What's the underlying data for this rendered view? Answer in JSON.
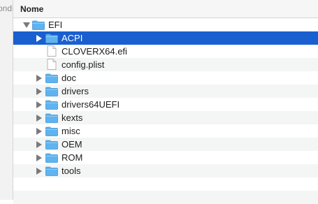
{
  "sidebar": {
    "clipped_label": "ondi"
  },
  "header": {
    "column_title": "Nome"
  },
  "colors": {
    "selection": "#1a5fcf",
    "folder": "#5fb3ef"
  },
  "rows": [
    {
      "name": "EFI",
      "kind": "folder",
      "level": 0,
      "disclosure": "expanded",
      "selected": false,
      "icon": "folder-icon"
    },
    {
      "name": "ACPI",
      "kind": "folder",
      "level": 1,
      "disclosure": "collapsed",
      "selected": true,
      "icon": "folder-icon"
    },
    {
      "name": "CLOVERX64.efi",
      "kind": "file",
      "level": 1,
      "disclosure": "none",
      "selected": false,
      "icon": "document-icon"
    },
    {
      "name": "config.plist",
      "kind": "file",
      "level": 1,
      "disclosure": "none",
      "selected": false,
      "icon": "document-icon"
    },
    {
      "name": "doc",
      "kind": "folder",
      "level": 1,
      "disclosure": "collapsed",
      "selected": false,
      "icon": "folder-icon"
    },
    {
      "name": "drivers",
      "kind": "folder",
      "level": 1,
      "disclosure": "collapsed",
      "selected": false,
      "icon": "folder-icon"
    },
    {
      "name": "drivers64UEFI",
      "kind": "folder",
      "level": 1,
      "disclosure": "collapsed",
      "selected": false,
      "icon": "folder-icon"
    },
    {
      "name": "kexts",
      "kind": "folder",
      "level": 1,
      "disclosure": "collapsed",
      "selected": false,
      "icon": "folder-icon"
    },
    {
      "name": "misc",
      "kind": "folder",
      "level": 1,
      "disclosure": "collapsed",
      "selected": false,
      "icon": "folder-icon"
    },
    {
      "name": "OEM",
      "kind": "folder",
      "level": 1,
      "disclosure": "collapsed",
      "selected": false,
      "icon": "folder-icon"
    },
    {
      "name": "ROM",
      "kind": "folder",
      "level": 1,
      "disclosure": "collapsed",
      "selected": false,
      "icon": "folder-icon"
    },
    {
      "name": "tools",
      "kind": "folder",
      "level": 1,
      "disclosure": "collapsed",
      "selected": false,
      "icon": "folder-icon"
    }
  ]
}
